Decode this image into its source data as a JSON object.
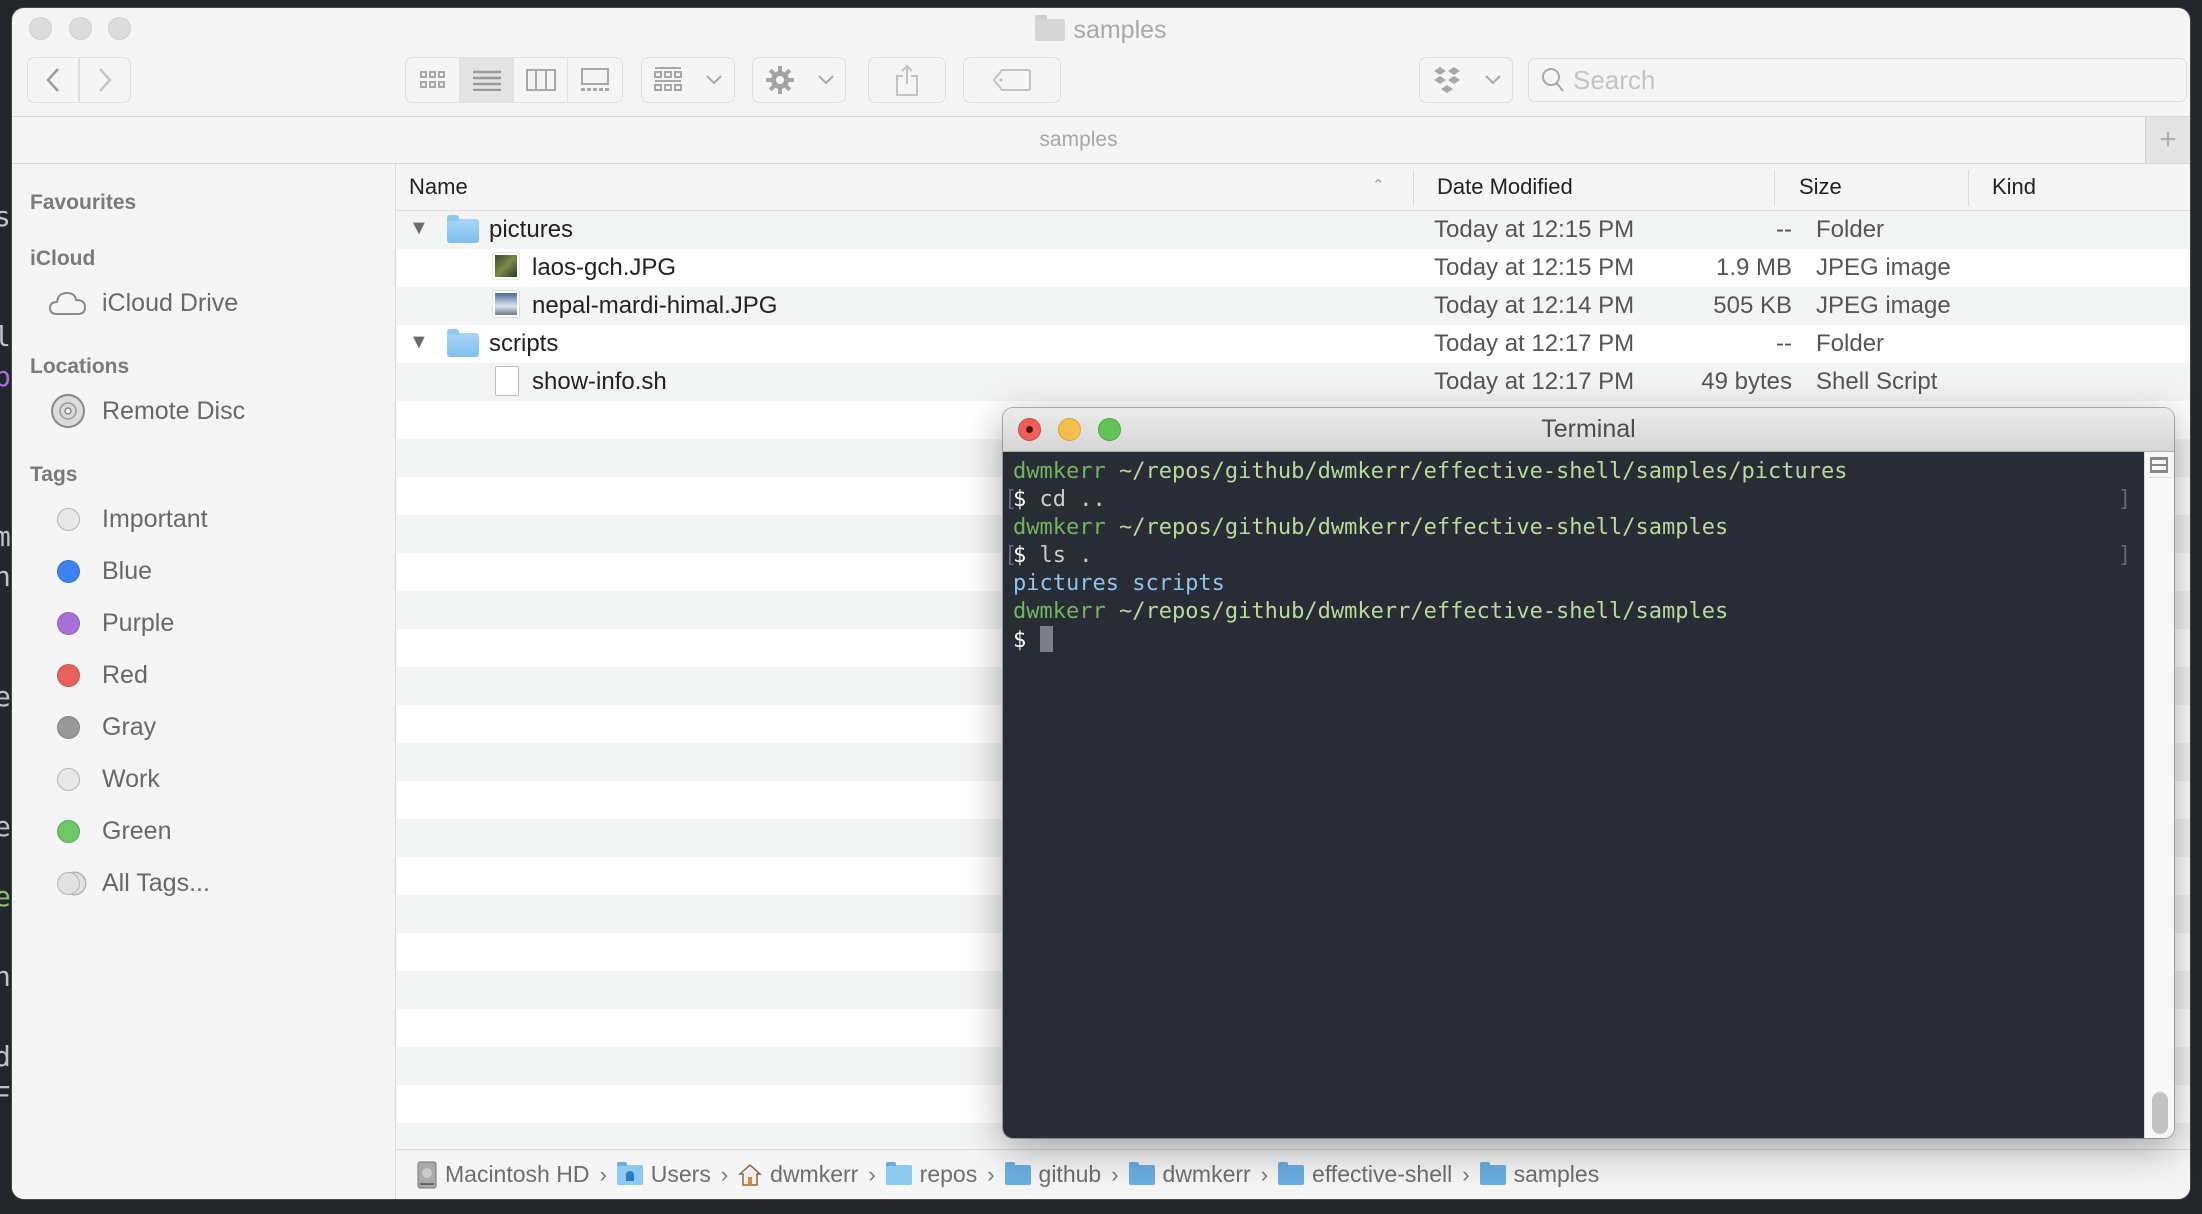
{
  "background_text": [
    "s",
    "l",
    "p",
    "m",
    "n",
    "e",
    "e",
    "e",
    "h",
    "d",
    "F"
  ],
  "finder": {
    "window_title": "samples",
    "toolbar": {
      "back_icon": "chevron-left-icon",
      "forward_icon": "chevron-right-icon",
      "view_modes": [
        "icon-view",
        "list-view",
        "column-view",
        "gallery-view"
      ],
      "active_view": "list-view",
      "group_icon": "group-by-icon",
      "action_icon": "gear-icon",
      "share_icon": "share-icon",
      "tag_icon": "tag-icon",
      "dropbox_icon": "dropbox-icon",
      "search_placeholder": "Search",
      "search_value": ""
    },
    "tab_title": "samples",
    "tab_add": "+",
    "sidebar": {
      "sections": [
        {
          "title": "Favourites",
          "items": []
        },
        {
          "title": "iCloud",
          "items": [
            {
              "label": "iCloud Drive",
              "icon": "cloud-icon"
            }
          ]
        },
        {
          "title": "Locations",
          "items": [
            {
              "label": "Remote Disc",
              "icon": "disc-icon"
            }
          ]
        },
        {
          "title": "Tags",
          "items": [
            {
              "label": "Important",
              "color": "#e8e8e8"
            },
            {
              "label": "Blue",
              "color": "#3d82f2"
            },
            {
              "label": "Purple",
              "color": "#a86fd6"
            },
            {
              "label": "Red",
              "color": "#e9625a"
            },
            {
              "label": "Gray",
              "color": "#999999"
            },
            {
              "label": "Work",
              "color": "#e8e8e8"
            },
            {
              "label": "Green",
              "color": "#6ec766"
            },
            {
              "label": "All Tags...",
              "color": "#e2e2e2"
            }
          ]
        }
      ]
    },
    "columns": {
      "name": "Name",
      "date": "Date Modified",
      "size": "Size",
      "kind": "Kind"
    },
    "files": [
      {
        "name": "pictures",
        "date": "Today at 12:15 PM",
        "size": "--",
        "kind": "Folder",
        "type": "folder",
        "expanded": true,
        "level": 0
      },
      {
        "name": "laos-gch.JPG",
        "date": "Today at 12:15 PM",
        "size": "1.9 MB",
        "kind": "JPEG image",
        "type": "image",
        "level": 1
      },
      {
        "name": "nepal-mardi-himal.JPG",
        "date": "Today at 12:14 PM",
        "size": "505 KB",
        "kind": "JPEG image",
        "type": "image",
        "level": 1
      },
      {
        "name": "scripts",
        "date": "Today at 12:17 PM",
        "size": "--",
        "kind": "Folder",
        "type": "folder",
        "expanded": true,
        "level": 0
      },
      {
        "name": "show-info.sh",
        "date": "Today at 12:17 PM",
        "size": "49 bytes",
        "kind": "Shell Script",
        "type": "document",
        "level": 1
      }
    ],
    "path_bar": [
      {
        "label": "Macintosh HD",
        "icon": "hard-drive-icon"
      },
      {
        "label": "Users",
        "icon": "users-folder-icon"
      },
      {
        "label": "dwmkerr",
        "icon": "home-icon"
      },
      {
        "label": "repos",
        "icon": "folder-icon"
      },
      {
        "label": "github",
        "icon": "folder-icon"
      },
      {
        "label": "dwmkerr",
        "icon": "folder-icon"
      },
      {
        "label": "effective-shell",
        "icon": "folder-icon"
      },
      {
        "label": "samples",
        "icon": "folder-icon"
      }
    ],
    "path_separator": "›"
  },
  "terminal": {
    "title": "Terminal",
    "lines": [
      {
        "type": "prompt",
        "user": "dwmkerr",
        "path": "~/repos/github/dwmkerr/effective-shell/samples/pictures"
      },
      {
        "type": "command",
        "dollar": "$",
        "cmd": "cd ..",
        "marked": true
      },
      {
        "type": "prompt",
        "user": "dwmkerr",
        "path": "~/repos/github/dwmkerr/effective-shell/samples"
      },
      {
        "type": "command",
        "dollar": "$",
        "cmd": "ls .",
        "marked": true
      },
      {
        "type": "output",
        "text": "pictures scripts"
      },
      {
        "type": "prompt",
        "user": "dwmkerr",
        "path": "~/repos/github/dwmkerr/effective-shell/samples"
      },
      {
        "type": "input",
        "dollar": "$",
        "cmd": ""
      }
    ]
  }
}
